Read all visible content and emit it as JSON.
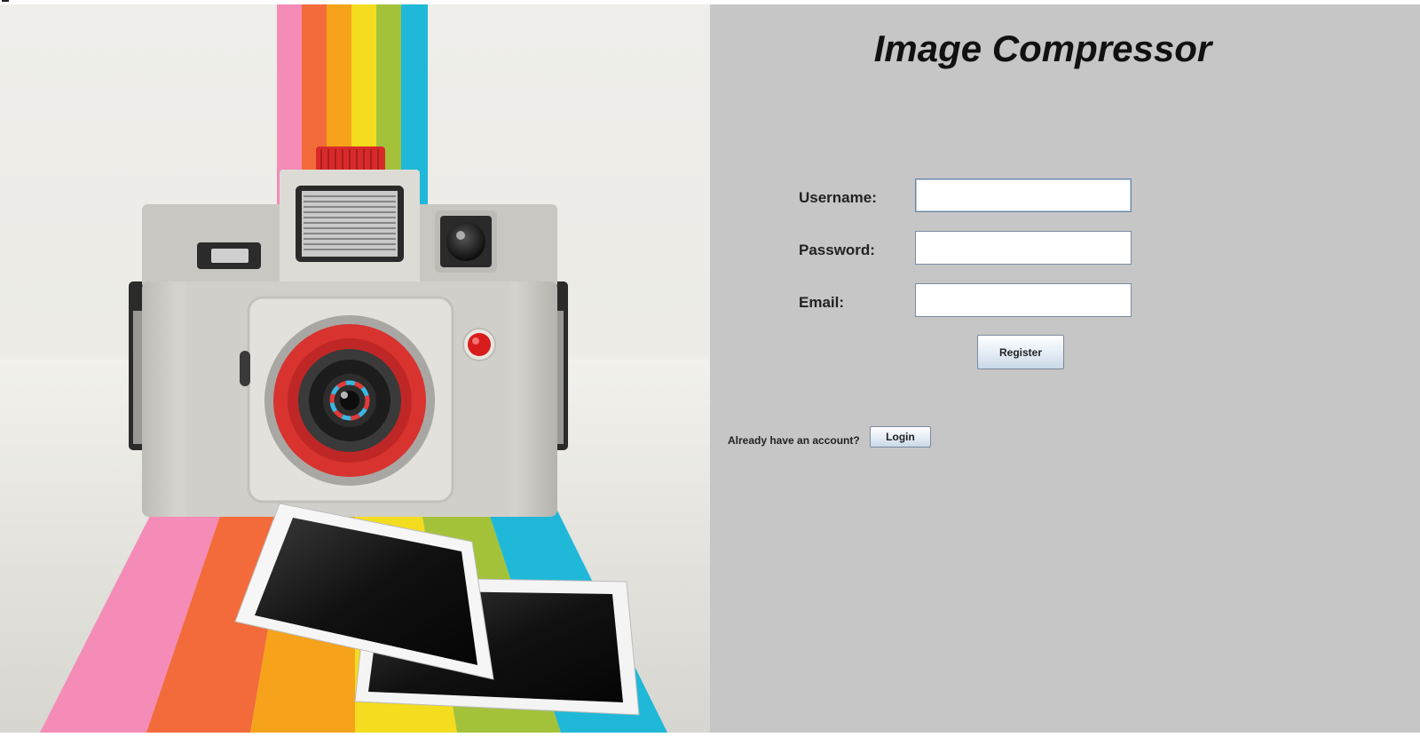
{
  "app": {
    "title": "Image Compressor"
  },
  "form": {
    "username_label": "Username:",
    "username_value": "",
    "password_label": "Password:",
    "password_value": "",
    "email_label": "Email:",
    "email_value": "",
    "register_label": "Register"
  },
  "footer": {
    "prompt": "Already have an account?",
    "login_label": "Login"
  },
  "colors": {
    "panel_bg": "#c6c6c6",
    "hero_bg": "#efeeea",
    "button_gradient_bottom": "#c9d8e8",
    "camera_lens_red": "#d8332f"
  },
  "icons": {
    "hero": "retro-camera-illustration"
  }
}
